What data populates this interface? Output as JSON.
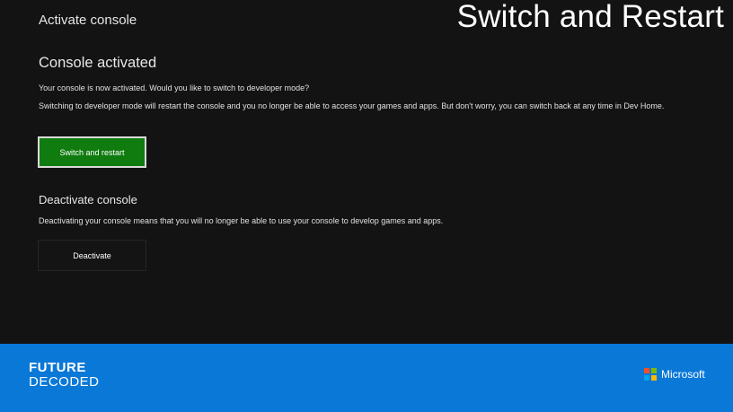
{
  "slide": {
    "title": "Switch and Restart"
  },
  "header": {
    "title": "Activate console"
  },
  "activated": {
    "heading": "Console activated",
    "question": "Your console is now activated. Would you like to switch to developer mode?",
    "warning": "Switching to developer mode will restart the console and you no longer be able to access your games and apps. But don't worry, you can switch back at any time in Dev Home.",
    "primary_button": "Switch and restart"
  },
  "deactivate": {
    "heading": "Deactivate console",
    "description": "Deactivating your console means that you will no longer be able to use your console to develop games and apps.",
    "button": "Deactivate"
  },
  "footer": {
    "event_line1": "FUTURE",
    "event_line2": "DECODED",
    "brand": "Microsoft",
    "brand_logo_colors": [
      "#f25022",
      "#7fba00",
      "#00a4ef",
      "#ffb900"
    ],
    "background_color": "#0a78d7"
  },
  "colors": {
    "primary_button": "#107c10",
    "background": "#131313"
  }
}
